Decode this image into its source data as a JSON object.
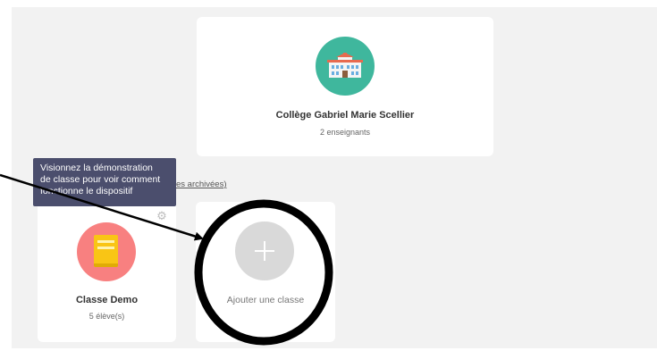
{
  "school": {
    "name": "Collège Gabriel Marie Scellier",
    "teachers": "2 enseignants",
    "icon": "school-building-icon",
    "avatar_color": "#3fb79d"
  },
  "archived_link": "es archivées)",
  "tooltip": {
    "lines": [
      "Visionnez la démonstration",
      "de classe pour voir comment",
      "fonctionne le dispositif"
    ],
    "background": "#4b4e6d"
  },
  "classes": [
    {
      "name": "Classe Demo",
      "students": "5 élève(s)",
      "icon": "book-icon",
      "avatar_color": "#f88080",
      "settings_icon": "gear-icon"
    }
  ],
  "add_class": {
    "label": "Ajouter une classe",
    "icon": "plus-icon"
  },
  "annotation": {
    "arrow_color": "#000000",
    "circle_color": "#000000"
  }
}
